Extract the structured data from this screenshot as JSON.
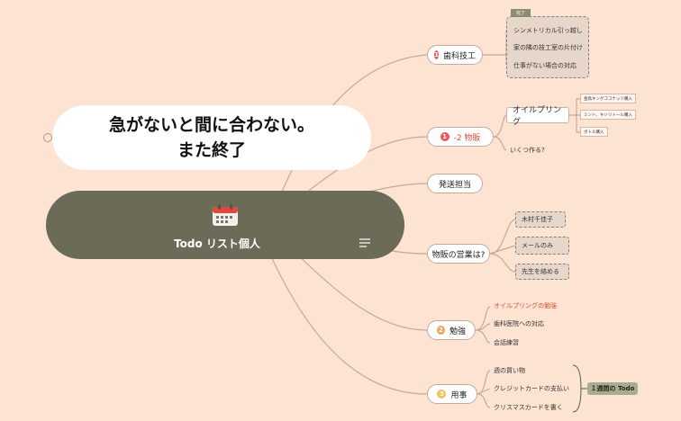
{
  "callout": {
    "line1": "急がないと間に合わない。",
    "line2": "また終了"
  },
  "central": {
    "title": "Todo リスト個人"
  },
  "branches": [
    {
      "number": "1",
      "label": "歯科技工",
      "color": "#e85a5a"
    },
    {
      "number": "1",
      "label": "-2 物販",
      "color": "#e85a5a"
    },
    {
      "number": "",
      "label": "発送担当",
      "color": ""
    },
    {
      "number": "",
      "label": "物販の営業は?",
      "color": ""
    },
    {
      "number": "2",
      "label": "勉強",
      "color": "#f0a35a"
    },
    {
      "number": "3",
      "label": "用事",
      "color": "#f0c05a"
    }
  ],
  "dental": {
    "done_tag": "完了",
    "items": [
      "シンメトリカル引っ越し",
      "家の隣の技工室の片付け",
      "仕事がない場合の対応"
    ]
  },
  "sales": {
    "oil": "オイルプリング",
    "oil_items": [
      "金鳥キングココナッツ購入",
      "ミント、キシリトール購入",
      "ボトル購入"
    ],
    "make": "いくつ作る?"
  },
  "eigyo": {
    "items": [
      "木村千佳子",
      "メールのみ",
      "先生を絡める"
    ]
  },
  "study": {
    "items": [
      "オイルプリングの勉強",
      "歯科医院への対応",
      "会話練習"
    ],
    "highlight_color": "#d9503a"
  },
  "errands": {
    "items": [
      "週の買い物",
      "クレジットカードの支払い",
      "クリスマスカードを書く"
    ],
    "summary": "１週間の Todo"
  },
  "colors": {
    "background": "#fde3d2",
    "central": "#6b6b57",
    "line": "#c9a898"
  }
}
